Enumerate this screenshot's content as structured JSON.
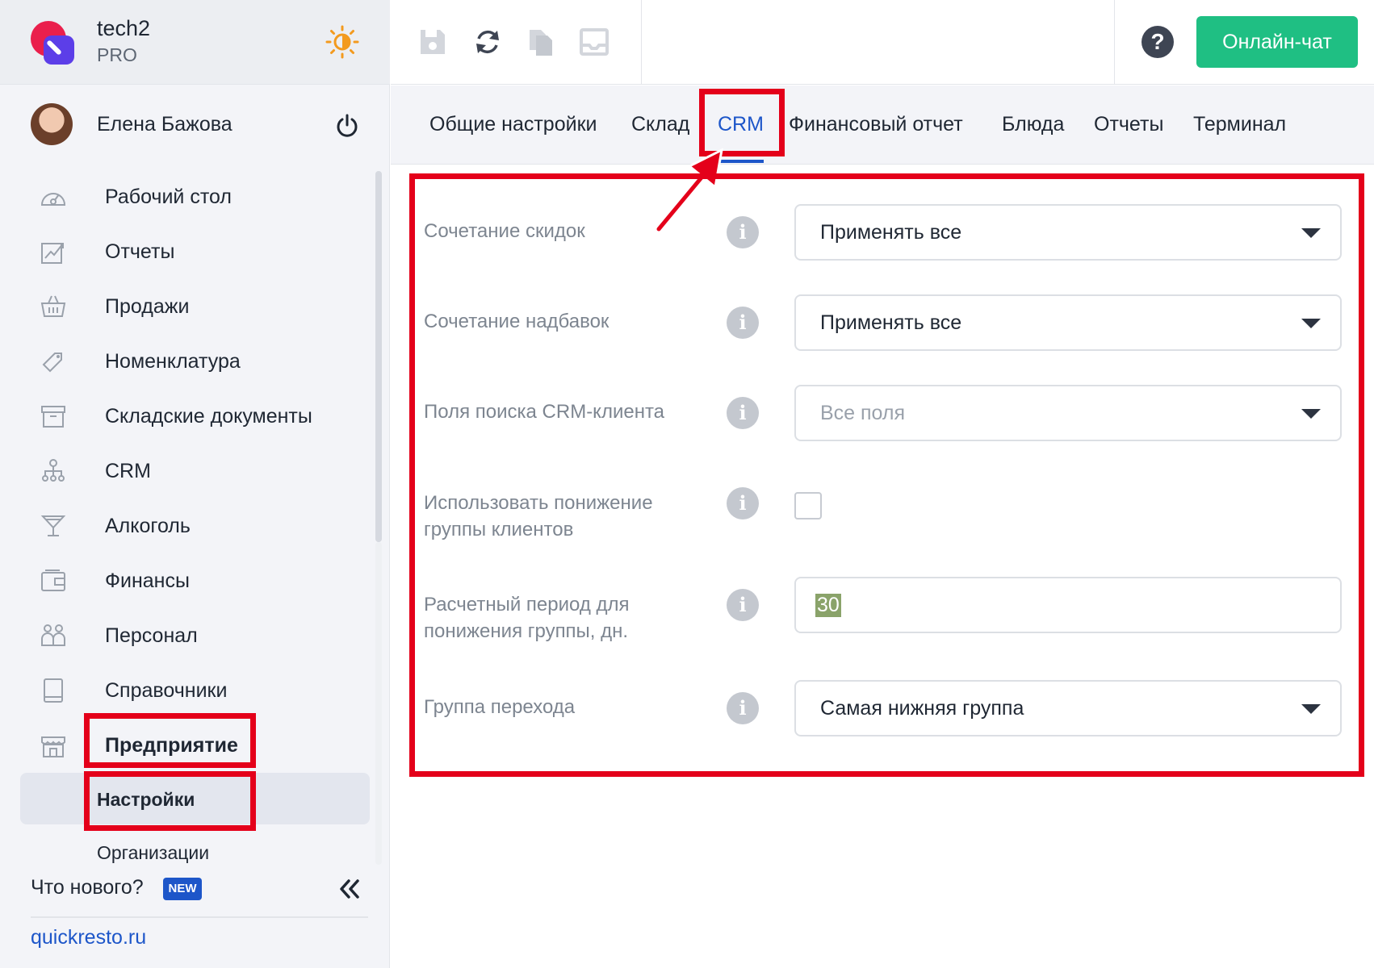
{
  "brand": {
    "name": "tech2",
    "plan": "PRO"
  },
  "user": {
    "name": "Елена Бажова"
  },
  "nav": {
    "items": [
      {
        "label": "Рабочий стол",
        "icon": "dashboard-icon"
      },
      {
        "label": "Отчеты",
        "icon": "reports-icon"
      },
      {
        "label": "Продажи",
        "icon": "basket-icon"
      },
      {
        "label": "Номенклатура",
        "icon": "tag-icon"
      },
      {
        "label": "Складские документы",
        "icon": "archive-icon"
      },
      {
        "label": "CRM",
        "icon": "crm-icon"
      },
      {
        "label": "Алкоголь",
        "icon": "cocktail-icon"
      },
      {
        "label": "Финансы",
        "icon": "wallet-icon"
      },
      {
        "label": "Персонал",
        "icon": "people-icon"
      },
      {
        "label": "Справочники",
        "icon": "book-icon"
      },
      {
        "label": "Предприятие",
        "icon": "store-icon"
      }
    ],
    "sub_items": [
      {
        "label": "Настройки"
      },
      {
        "label": "Организации"
      }
    ]
  },
  "footer": {
    "whats_new": "Что нового?",
    "new_badge": "NEW",
    "site": "quickresto.ru"
  },
  "header": {
    "chat_label": "Онлайн-чат",
    "help": "?"
  },
  "tabs": [
    {
      "label": "Общие настройки"
    },
    {
      "label": "Склад"
    },
    {
      "label": "CRM"
    },
    {
      "label": "Финансовый отчет"
    },
    {
      "label": "Блюда"
    },
    {
      "label": "Отчеты"
    },
    {
      "label": "Терминал"
    }
  ],
  "form": {
    "rows": [
      {
        "label": "Сочетание скидок",
        "value": "Применять все",
        "type": "select"
      },
      {
        "label": "Сочетание надбавок",
        "value": "Применять все",
        "type": "select"
      },
      {
        "label": "Поля поиска CRM-клиента",
        "placeholder": "Все поля",
        "type": "select"
      },
      {
        "label_line1": "Использовать понижение",
        "label_line2": "группы клиентов",
        "type": "checkbox",
        "checked": false
      },
      {
        "label_line1": "Расчетный период для",
        "label_line2": "понижения группы, дн.",
        "value": "30",
        "type": "number"
      },
      {
        "label": "Группа перехода",
        "value": "Самая нижняя группа",
        "type": "select"
      }
    ],
    "info_glyph": "i"
  },
  "colors": {
    "accent": "#1d56c9",
    "chat": "#1fbf83",
    "highlight": "#e4001a"
  }
}
